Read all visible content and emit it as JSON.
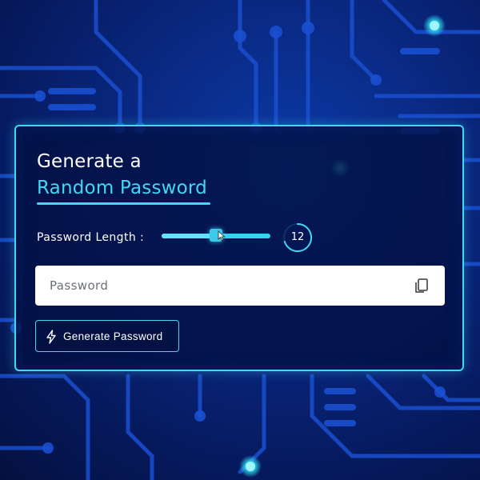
{
  "title": {
    "line1": "Generate a",
    "line2": "Random Password"
  },
  "length": {
    "label": "Password Length :",
    "value": "12",
    "slider_fraction": 0.5
  },
  "password": {
    "placeholder": "Password",
    "value": ""
  },
  "generate": {
    "label": "Generate Password",
    "icon": "lightning-icon"
  },
  "copy": {
    "icon": "copy-icon"
  },
  "colors": {
    "accent": "#43d7f3",
    "background": "#0a2a85",
    "field": "#ffffff"
  }
}
